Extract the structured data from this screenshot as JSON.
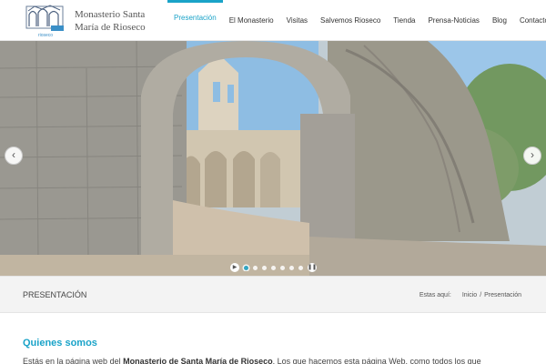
{
  "site": {
    "name": "Monasterio Santa María de Rioseco",
    "logo_text": "rioseco"
  },
  "nav": {
    "items": [
      "Presentación",
      "El Monasterio",
      "Visitas",
      "Salvemos Rioseco",
      "Tienda",
      "Prensa-Noticias",
      "Blog",
      "Contacto"
    ],
    "active": "Presentación"
  },
  "slider": {
    "prev_icon": "chevron-left-icon",
    "next_icon": "chevron-right-icon",
    "slide_count": 7,
    "active_slide": 1
  },
  "breadcrumb_bar": {
    "title": "PRESENTACIÓN",
    "prefix": "Estas aquí:",
    "items": [
      "Inicio",
      "Presentación"
    ],
    "separator": "/"
  },
  "content": {
    "heading": "Quienes somos",
    "intro_start": "Estás en la página web del ",
    "intro_bold": "Monasterio de Santa María de Rioseco",
    "intro_end": ". Los que hacemos esta página Web, como todos los que"
  },
  "colors": {
    "accent": "#1aa3c8",
    "crumb_bg": "#f3f3f3"
  }
}
